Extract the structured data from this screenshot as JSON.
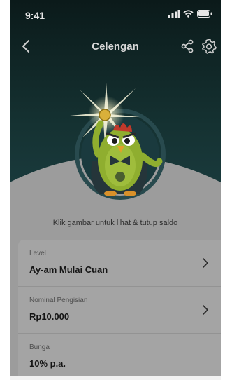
{
  "status_bar": {
    "time": "9:41"
  },
  "header": {
    "title": "Celengan"
  },
  "hero": {
    "hint": "Klik gambar untuk lihat & tutup saldo"
  },
  "details": {
    "level_label": "Level",
    "level_value": "Ay-am Mulai Cuan",
    "nominal_label": "Nominal Pengisian",
    "nominal_value": "Rp10.000",
    "interest_label": "Bunga",
    "interest_value": "10% p.a."
  },
  "colors": {
    "hero_dark": "#0d1c1c",
    "overlay_gray": "#9c9c9c",
    "mascot_green": "#8fae2f"
  },
  "icons": [
    "back-icon",
    "share-icon",
    "gear-icon",
    "chevron-right-icon",
    "signal-icon",
    "wifi-icon",
    "battery-icon"
  ]
}
